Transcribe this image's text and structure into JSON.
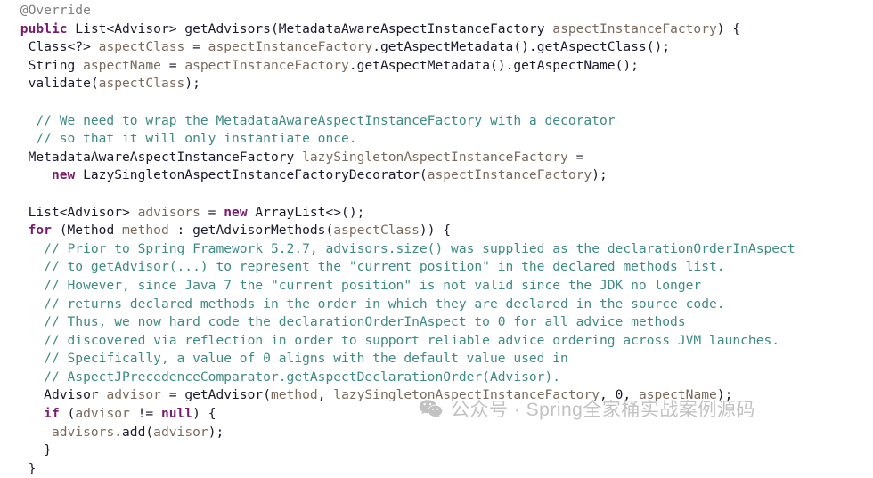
{
  "viewer": {
    "name": "java-source-code-snippet",
    "background_color": "#ffffff",
    "font_size_px": 14.6
  },
  "theme": {
    "text_color": "#1a1a2e",
    "keyword_color": "#7a1b6b",
    "comment_color": "#3f8a84",
    "parameter_color": "#7b6a5c",
    "annotation_color": "#808080",
    "watermark_color": "#c2c2c2"
  },
  "code": {
    "language": "Java",
    "lines": [
      {
        "n": 1,
        "indent": 1,
        "segments": [
          {
            "t": "annotation",
            "s": "@Override"
          }
        ]
      },
      {
        "n": 2,
        "indent": 1,
        "segments": [
          {
            "t": "keyword",
            "s": "public"
          },
          {
            "t": "plain",
            "s": " List<Advisor> getAdvisors("
          },
          {
            "t": "plain",
            "s": "MetadataAwareAspectInstanceFactory "
          },
          {
            "t": "param",
            "s": "aspectInstanceFactory"
          },
          {
            "t": "plain",
            "s": ") {"
          }
        ]
      },
      {
        "n": 3,
        "indent": 2,
        "segments": [
          {
            "t": "plain",
            "s": "Class<?> "
          },
          {
            "t": "param",
            "s": "aspectClass"
          },
          {
            "t": "plain",
            "s": " = "
          },
          {
            "t": "param",
            "s": "aspectInstanceFactory"
          },
          {
            "t": "plain",
            "s": ".getAspectMetadata().getAspectClass();"
          }
        ]
      },
      {
        "n": 4,
        "indent": 2,
        "segments": [
          {
            "t": "plain",
            "s": "String "
          },
          {
            "t": "param",
            "s": "aspectName"
          },
          {
            "t": "plain",
            "s": " = "
          },
          {
            "t": "param",
            "s": "aspectInstanceFactory"
          },
          {
            "t": "plain",
            "s": ".getAspectMetadata().getAspectName();"
          }
        ]
      },
      {
        "n": 5,
        "indent": 2,
        "segments": [
          {
            "t": "plain",
            "s": "validate("
          },
          {
            "t": "param",
            "s": "aspectClass"
          },
          {
            "t": "plain",
            "s": ");"
          }
        ]
      },
      {
        "n": 6,
        "indent": 0,
        "segments": [
          {
            "t": "plain",
            "s": ""
          }
        ]
      },
      {
        "n": 7,
        "indent": 3,
        "segments": [
          {
            "t": "comment",
            "s": "// We need to wrap the MetadataAwareAspectInstanceFactory with a decorator"
          }
        ]
      },
      {
        "n": 8,
        "indent": 3,
        "segments": [
          {
            "t": "comment",
            "s": "// so that it will only instantiate once."
          }
        ]
      },
      {
        "n": 9,
        "indent": 2,
        "segments": [
          {
            "t": "plain",
            "s": "MetadataAwareAspectInstanceFactory "
          },
          {
            "t": "param",
            "s": "lazySingletonAspectInstanceFactory"
          },
          {
            "t": "plain",
            "s": " ="
          }
        ]
      },
      {
        "n": 10,
        "indent": 5,
        "segments": [
          {
            "t": "keyword",
            "s": "new"
          },
          {
            "t": "plain",
            "s": " LazySingletonAspectInstanceFactoryDecorator("
          },
          {
            "t": "param",
            "s": "aspectInstanceFactory"
          },
          {
            "t": "plain",
            "s": ");"
          }
        ]
      },
      {
        "n": 11,
        "indent": 0,
        "segments": [
          {
            "t": "plain",
            "s": ""
          }
        ]
      },
      {
        "n": 12,
        "indent": 2,
        "segments": [
          {
            "t": "plain",
            "s": "List<Advisor> "
          },
          {
            "t": "param",
            "s": "advisors"
          },
          {
            "t": "plain",
            "s": " = "
          },
          {
            "t": "keyword",
            "s": "new"
          },
          {
            "t": "plain",
            "s": " ArrayList<>();"
          }
        ]
      },
      {
        "n": 13,
        "indent": 2,
        "segments": [
          {
            "t": "keyword",
            "s": "for"
          },
          {
            "t": "plain",
            "s": " (Method "
          },
          {
            "t": "param",
            "s": "method"
          },
          {
            "t": "plain",
            "s": " : getAdvisorMethods("
          },
          {
            "t": "param",
            "s": "aspectClass"
          },
          {
            "t": "plain",
            "s": ")) {"
          }
        ]
      },
      {
        "n": 14,
        "indent": 4,
        "segments": [
          {
            "t": "comment",
            "s": "// Prior to Spring Framework 5.2.7, advisors.size() was supplied as the declarationOrderInAspect"
          }
        ]
      },
      {
        "n": 15,
        "indent": 4,
        "segments": [
          {
            "t": "comment",
            "s": "// to getAdvisor(...) to represent the \"current position\" in the declared methods list."
          }
        ]
      },
      {
        "n": 16,
        "indent": 4,
        "segments": [
          {
            "t": "comment",
            "s": "// However, since Java 7 the \"current position\" is not valid since the JDK no longer"
          }
        ]
      },
      {
        "n": 17,
        "indent": 4,
        "segments": [
          {
            "t": "comment",
            "s": "// returns declared methods in the order in which they are declared in the source code."
          }
        ]
      },
      {
        "n": 18,
        "indent": 4,
        "segments": [
          {
            "t": "comment",
            "s": "// Thus, we now hard code the declarationOrderInAspect to 0 for all advice methods"
          }
        ]
      },
      {
        "n": 19,
        "indent": 4,
        "segments": [
          {
            "t": "comment",
            "s": "// discovered via reflection in order to support reliable advice ordering across JVM launches."
          }
        ]
      },
      {
        "n": 20,
        "indent": 4,
        "segments": [
          {
            "t": "comment",
            "s": "// Specifically, a value of 0 aligns with the default value used in"
          }
        ]
      },
      {
        "n": 21,
        "indent": 4,
        "segments": [
          {
            "t": "comment",
            "s": "// AspectJPrecedenceComparator.getAspectDeclarationOrder(Advisor)."
          }
        ]
      },
      {
        "n": 22,
        "indent": 4,
        "segments": [
          {
            "t": "plain",
            "s": "Advisor "
          },
          {
            "t": "param",
            "s": "advisor"
          },
          {
            "t": "plain",
            "s": " = getAdvisor("
          },
          {
            "t": "param",
            "s": "method"
          },
          {
            "t": "plain",
            "s": ", "
          },
          {
            "t": "param",
            "s": "lazySingletonAspectInstanceFactory"
          },
          {
            "t": "plain",
            "s": ", 0, "
          },
          {
            "t": "param",
            "s": "aspectName"
          },
          {
            "t": "plain",
            "s": ");"
          }
        ]
      },
      {
        "n": 23,
        "indent": 4,
        "segments": [
          {
            "t": "keyword",
            "s": "if"
          },
          {
            "t": "plain",
            "s": " ("
          },
          {
            "t": "param",
            "s": "advisor"
          },
          {
            "t": "plain",
            "s": " != "
          },
          {
            "t": "keyword",
            "s": "null"
          },
          {
            "t": "plain",
            "s": ") {"
          }
        ]
      },
      {
        "n": 24,
        "indent": 5,
        "segments": [
          {
            "t": "param",
            "s": "advisors"
          },
          {
            "t": "plain",
            "s": ".add("
          },
          {
            "t": "param",
            "s": "advisor"
          },
          {
            "t": "plain",
            "s": ");"
          }
        ]
      },
      {
        "n": 25,
        "indent": 4,
        "segments": [
          {
            "t": "plain",
            "s": "}"
          }
        ]
      },
      {
        "n": 26,
        "indent": 2,
        "segments": [
          {
            "t": "plain",
            "s": "}"
          }
        ]
      }
    ]
  },
  "watermark": {
    "icon": "wechat-icon",
    "text": "公众号 · Spring全家桶实战案例源码"
  }
}
